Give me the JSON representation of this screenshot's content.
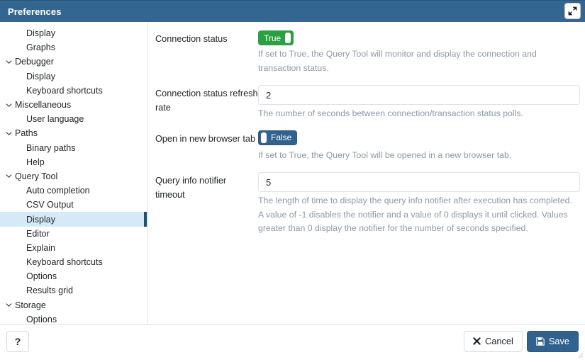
{
  "titlebar": {
    "title": "Preferences",
    "maximize_icon": "maximize-icon"
  },
  "sidebar": {
    "items": [
      {
        "label": "Display",
        "type": "child",
        "selected": false
      },
      {
        "label": "Graphs",
        "type": "child",
        "selected": false
      },
      {
        "label": "Debugger",
        "type": "parent",
        "selected": false
      },
      {
        "label": "Display",
        "type": "child",
        "selected": false
      },
      {
        "label": "Keyboard shortcuts",
        "type": "child",
        "selected": false
      },
      {
        "label": "Miscellaneous",
        "type": "parent",
        "selected": false
      },
      {
        "label": "User language",
        "type": "child",
        "selected": false
      },
      {
        "label": "Paths",
        "type": "parent",
        "selected": false
      },
      {
        "label": "Binary paths",
        "type": "child",
        "selected": false
      },
      {
        "label": "Help",
        "type": "child",
        "selected": false
      },
      {
        "label": "Query Tool",
        "type": "parent",
        "selected": false
      },
      {
        "label": "Auto completion",
        "type": "child",
        "selected": false
      },
      {
        "label": "CSV Output",
        "type": "child",
        "selected": false
      },
      {
        "label": "Display",
        "type": "child",
        "selected": true
      },
      {
        "label": "Editor",
        "type": "child",
        "selected": false
      },
      {
        "label": "Explain",
        "type": "child",
        "selected": false
      },
      {
        "label": "Keyboard shortcuts",
        "type": "child",
        "selected": false
      },
      {
        "label": "Options",
        "type": "child",
        "selected": false
      },
      {
        "label": "Results grid",
        "type": "child",
        "selected": false
      },
      {
        "label": "Storage",
        "type": "parent",
        "selected": false
      },
      {
        "label": "Options",
        "type": "child",
        "selected": false
      }
    ]
  },
  "settings": {
    "connection_status": {
      "label": "Connection status",
      "value": "True",
      "help": "If set to True, the Query Tool will monitor and display the connection and transaction status."
    },
    "refresh_rate": {
      "label": "Connection status refresh rate",
      "value": "2",
      "placeholder": "",
      "help": "The number of seconds between connection/transaction status polls."
    },
    "new_browser_tab": {
      "label": "Open in new browser tab",
      "value": "False",
      "help": "If set to True, the Query Tool will be opened in a new browser tab."
    },
    "notifier_timeout": {
      "label": "Query info notifier timeout",
      "value": "5",
      "placeholder": "",
      "help": "The length of time to display the query info notifier after execution has completed. A value of -1 disables the notifier and a value of 0 displays it until clicked. Values greater than 0 display the notifier for the number of seconds specified."
    }
  },
  "footer": {
    "help_label": "?",
    "cancel_label": "Cancel",
    "save_label": "Save"
  },
  "colors": {
    "titlebar": "#336791",
    "toggle_on": "#2d9f43",
    "toggle_off": "#31618e",
    "selection": "#d4ebf7",
    "selection_bar": "#1c4f76",
    "help_text": "#8e98a5"
  }
}
